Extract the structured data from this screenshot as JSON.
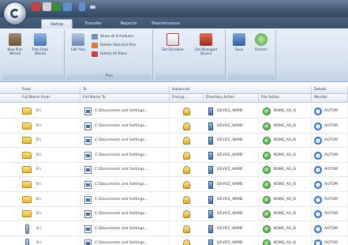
{
  "tabs": [
    "Setup",
    "Transfer",
    "Reports",
    "Maintenance"
  ],
  "ribbon": {
    "buttons": {
      "new_plan": "New Plan Wizard",
      "plan_date": "Plan Date Wizard",
      "edit_plan": "Edit Plan",
      "show_all": "Show all Schedules",
      "delete_selected": "Delete Selected Plan",
      "delete_all": "Delete All Plans",
      "set_schedule": "Set Schedule",
      "set_managed": "Set Managed Device",
      "save": "Save",
      "refresh": "Refresh"
    },
    "groups": {
      "g1": "",
      "g2": "Plan",
      "g3": "",
      "g4": ""
    }
  },
  "grid": {
    "header_groups": {
      "from": "From",
      "to": "To",
      "advanced": "Advanced",
      "details": "Details"
    },
    "columns": [
      "Full Name From",
      "Full Name To",
      "Encryp...",
      "Directory Action",
      "File Action",
      "Monitor"
    ],
    "rows": [
      {
        "from": "0:\\",
        "to": "C:\\Documents and Settings...",
        "dir": "DEVICE_NAME",
        "file": "NONE_AS_IS",
        "monitor": "AUTOM"
      },
      {
        "from": "0:\\",
        "to": "C:\\Documents and Settings...",
        "dir": "DEVICE_NAME",
        "file": "NONE_AS_IS",
        "monitor": "AUTOM"
      },
      {
        "from": "0:\\",
        "to": "C:\\Documents and Settings...",
        "dir": "DEVICE_NAME",
        "file": "NONE_AS_IS",
        "monitor": "AUTOM"
      },
      {
        "from": "0:\\",
        "to": "C:\\Documents and Settings...",
        "dir": "DEVICE_NAME",
        "file": "NONE_AS_IS",
        "monitor": "AUTOM"
      },
      {
        "from": "0:\\",
        "to": "C:\\Documents and Settings...",
        "dir": "DEVICE_NAME",
        "file": "NONE_AS_IS",
        "monitor": "AUTOM"
      },
      {
        "from": "0:\\",
        "to": "C:\\Documents and Settings...",
        "dir": "DEVICE_NAME",
        "file": "NONE_AS_IS",
        "monitor": "AUTOM"
      },
      {
        "from": "0:\\",
        "to": "C:\\Documents and Settings...",
        "dir": "DEVICE_NAME",
        "file": "NONE_AS_IS",
        "monitor": "AUTOM"
      },
      {
        "from": "0:\\",
        "to": "C:\\Documents and Settings...",
        "dir": "DEVICE_NAME",
        "file": "NONE_AS_IS",
        "monitor": "AUTOM"
      },
      {
        "from": "A:\\",
        "to": "C:\\Documents and Settings...",
        "dir": "DEVICE_NAME",
        "file": "NONE_AS_IS",
        "monitor": "AUTOM"
      },
      {
        "from": "A:\\",
        "to": "C:\\Documents and Settings...",
        "dir": "DEVICE_NAME",
        "file": "NONE_AS_IS",
        "monitor": "AUTOM"
      }
    ]
  }
}
